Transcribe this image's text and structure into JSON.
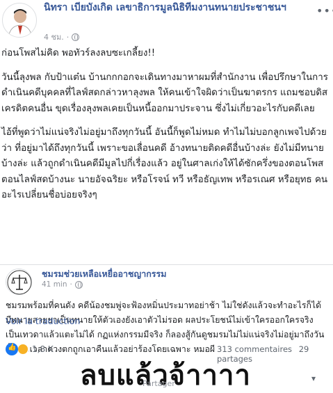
{
  "post": {
    "author": "นิทรา เบียบังเกิด เลขาธิการมูลนิธิทีมงานทนายประชาชนฯ",
    "time": "4 ชม.",
    "more_icon": "ellipsis-icon",
    "paragraphs": [
      "ก่อนโพสไม่คิด พอทัวร์ลงลบซะเกลี้ยง!!",
      "วันนี้ลุงพล กับป้าแต๋น บ้านกกกอกจะเดินทางมาหาผมที่สำนักงาน เพื่อปรึกษาในการดำเนินคดีบุคคลที่ไลฟ์สดกล่าวหาลุงพล ให้คนเข้าใจผิดว่าเป็นฆาตรกร แถมชอบดิสเครดิตคนอื่น ขุดเรื่องลุงพลเคยเป็นหนี้ออกมาประจาน ซึ่งไม่เกี่ยวอะไรกับคดีเลย",
      "ไอ้ที่พูดว่าไม่แน่จริงไม่อยู่มาถึงทุกวันนี้ อันนี้ก็พูดไม่หมด ทำไมไม่บอกลูกเพจไปด้วยว่า ที่อยู่มาได้ถึงทุกวันนี้ เพราะขอเลื่อนคดี อ้างทนายติดคดีอื่นบ้างล่ะ ยังไม่มีทนายบ้างล่ะ แล้วถูกดำเนินคดีมีมูลไปกี่เรื่องแล้ว อยู่ในศาลเก่งให้ได้ซักครึ่งของตอนโพสตอนไลฟ์สดบ้างนะ นายอัจฉริยะ หรือโรจน์ ทวี หรือธัญเทพ หรือรเณศ หรือยุทธ คนอะไรเปลี่ยนชื่อบ่อยจริงๆ"
    ]
  },
  "shared": {
    "author": "ชมรมช่วยเหลือเหยื่ออาชญากรรม",
    "time": "41 min",
    "text": "ชมรมพร้อมที่คนดัง คดีน้องชมพู่จะฟ้องหมิ่นประมาทอย่าช้า ไม่ใช่ดังแล้วจะทำอะไรก็ได้ มีทนายสายยาเป็นทนายให้ตัวเองยังเอาตัวไม่รอด ผลประโยชน์ไม่เข้าใครออกใครจริง เป็นเทวดาแล้วแตะไม่ได้ กฏแห่งกรรมมีจริง ก็ลองสู้กันดูชมรมไม่ไม่แน่จริงไม่อยู่มาถึงวันนี้ แล้วเวลาดวงตกถูกเอาคืนแล้วอย่าร้องโดยเฉพาะ หมอผี"
  },
  "translate_label": "Voir la traduction",
  "reactions": {
    "count": "1,8 K",
    "like_color": "#1877f2",
    "haha_color": "#f7b125"
  },
  "counts": {
    "comments": "313 commentaires",
    "shares": "29 partages"
  },
  "overlay": {
    "handwriting": "ลบแล้วจ้าาาา",
    "partage_hint": "Partager"
  }
}
